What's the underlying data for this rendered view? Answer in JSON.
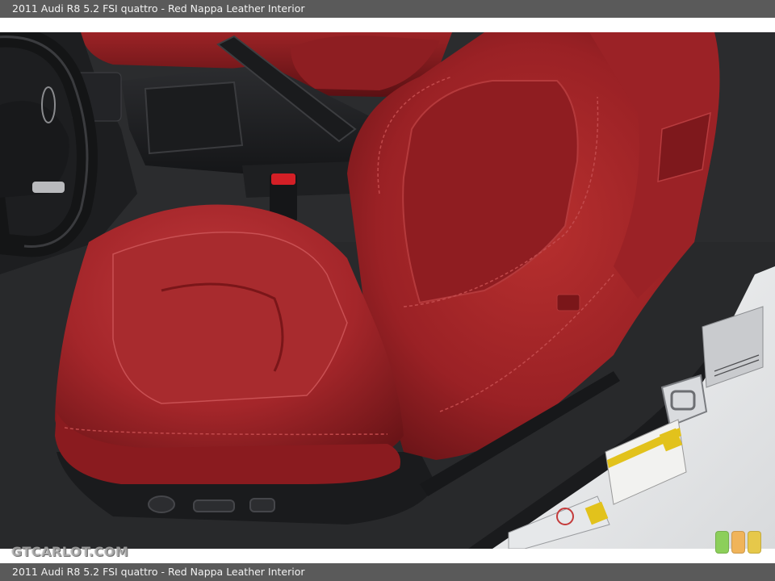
{
  "caption_top": "2011 Audi R8 5.2 FSI quattro - Red Nappa Leather Interior",
  "caption_bottom": "2011 Audi R8 5.2 FSI quattro - Red Nappa Leather Interior",
  "photo": {
    "subject": "Red Nappa Leather Interior",
    "colors": {
      "leather": "#a8262a",
      "leather_dark": "#6e1518",
      "leather_highlight": "#c9474a",
      "trim_black": "#1c1d1f",
      "carpet": "#2e2f31",
      "door_white": "#eef0f1"
    }
  },
  "watermark": "GTCARLOT.COM",
  "rating": {
    "colors": [
      "#8ccf5a",
      "#f0b45a",
      "#e6c84a"
    ]
  }
}
